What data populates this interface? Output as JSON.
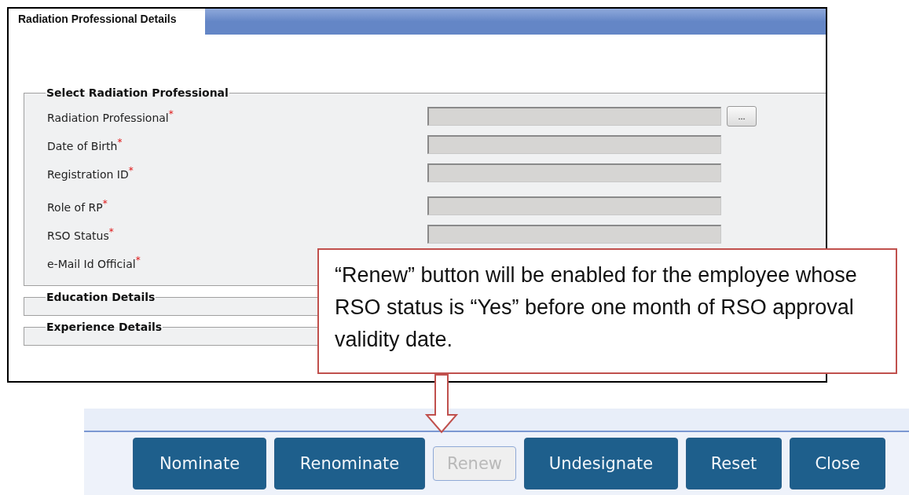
{
  "panel": {
    "tab": "Radiation Professional Details"
  },
  "select_section": {
    "title": "Select Radiation Professional",
    "fields": [
      {
        "label": "Radiation Professional$^{*}$",
        "kind": "lookup",
        "button": "..."
      },
      {
        "label": "Date of Birth$^{*}$",
        "kind": "text"
      },
      {
        "label": "Registration ID$^{*}$",
        "kind": "text"
      },
      {
        "label": "Role of RP$^{*}$",
        "kind": "text"
      },
      {
        "label": "RSO Status$^{*}$",
        "kind": "text"
      },
      {
        "label": "e-Mail Id Official$^{*}$",
        "kind": "label"
      }
    ]
  },
  "sections": [
    {
      "title": "Education Details"
    },
    {
      "title": "Experience Details"
    }
  ],
  "callout": {
    "text": "“Renew” button will be enabled for the employee whose RSO status is “Yes” before one month of RSO approval validity date."
  },
  "buttons": [
    {
      "label": "Nominate",
      "disabled": false
    },
    {
      "label": "Renominate",
      "disabled": false
    },
    {
      "label": "Renew",
      "disabled": true
    },
    {
      "label": "Undesignate",
      "disabled": false
    },
    {
      "label": "Reset",
      "disabled": false
    },
    {
      "label": "Close",
      "disabled": false
    }
  ]
}
